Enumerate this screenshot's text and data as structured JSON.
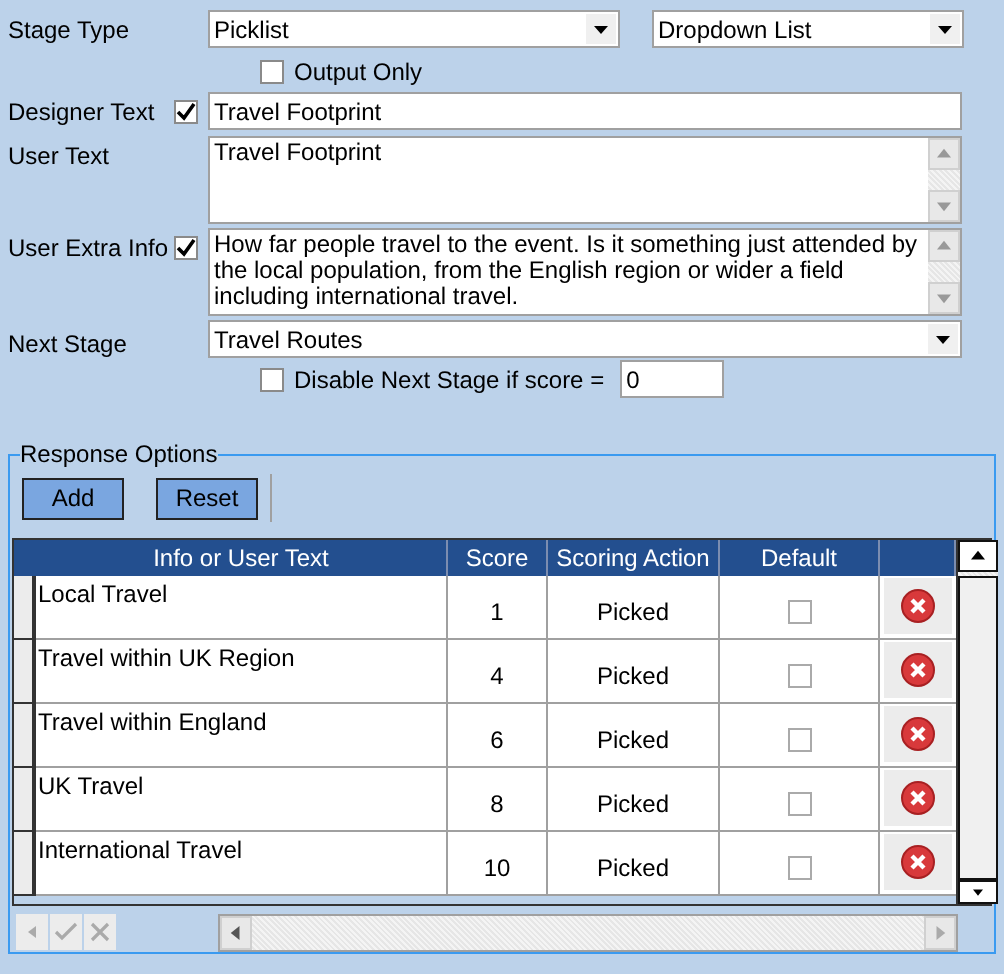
{
  "stage_type": {
    "label": "Stage Type",
    "value": "Picklist"
  },
  "display_type": {
    "value": "Dropdown List"
  },
  "output_only": {
    "label": "Output Only",
    "checked": false
  },
  "designer_text": {
    "label": "Designer Text",
    "checked": true,
    "value": "Travel Footprint"
  },
  "user_text": {
    "label": "User Text",
    "value": "Travel Footprint"
  },
  "user_extra_info": {
    "label": "User Extra Info",
    "checked": true,
    "value": "How far people travel to the event. Is it something just attended by the local population, from the English region or wider a field including international travel."
  },
  "next_stage": {
    "label": "Next Stage",
    "value": "Travel Routes"
  },
  "disable_next": {
    "label": "Disable Next Stage if score =",
    "checked": false,
    "value": "0"
  },
  "response_options": {
    "title": "Response Options",
    "buttons": [
      "Add",
      "Reset"
    ],
    "columns": [
      "Info or User Text",
      "Score",
      "Scoring Action",
      "Default"
    ],
    "rows": [
      {
        "text": "Local Travel",
        "score": "1",
        "action": "Picked",
        "default": false
      },
      {
        "text": "Travel within UK Region",
        "score": "4",
        "action": "Picked",
        "default": false
      },
      {
        "text": "Travel within England",
        "score": "6",
        "action": "Picked",
        "default": false
      },
      {
        "text": "UK Travel",
        "score": "8",
        "action": "Picked",
        "default": false
      },
      {
        "text": "International Travel",
        "score": "10",
        "action": "Picked",
        "default": false
      }
    ]
  }
}
